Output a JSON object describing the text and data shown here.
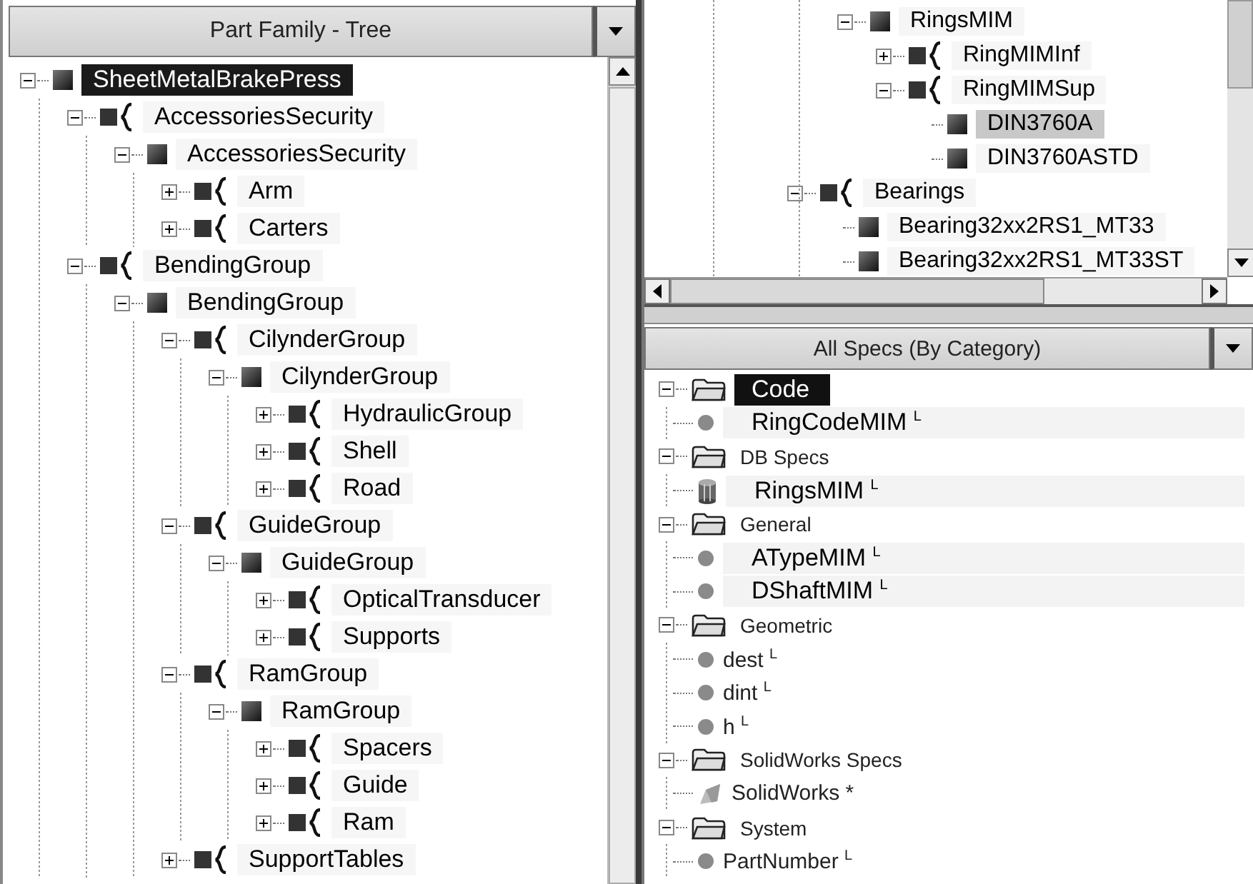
{
  "part_family_tree": {
    "header": "Part Family - Tree",
    "items": [
      {
        "kind": "part",
        "label": "SheetMetalBrakePress",
        "expanded": true,
        "selected": true,
        "children": [
          {
            "kind": "assembly",
            "label": "AccessoriesSecurity",
            "expanded": true,
            "selected": false,
            "children": [
              {
                "kind": "part",
                "label": "AccessoriesSecurity",
                "expanded": true,
                "selected": false,
                "children": [
                  {
                    "kind": "assembly",
                    "label": "Arm",
                    "expanded": false,
                    "selected": false
                  },
                  {
                    "kind": "assembly",
                    "label": "Carters",
                    "expanded": false,
                    "selected": false
                  }
                ]
              }
            ]
          },
          {
            "kind": "assembly",
            "label": "BendingGroup",
            "expanded": true,
            "selected": false,
            "children": [
              {
                "kind": "part",
                "label": "BendingGroup",
                "expanded": true,
                "selected": false,
                "children": [
                  {
                    "kind": "assembly",
                    "label": "CilynderGroup",
                    "expanded": true,
                    "selected": false,
                    "children": [
                      {
                        "kind": "part",
                        "label": "CilynderGroup",
                        "expanded": true,
                        "selected": false,
                        "children": [
                          {
                            "kind": "assembly",
                            "label": "HydraulicGroup",
                            "expanded": false,
                            "selected": false
                          },
                          {
                            "kind": "assembly",
                            "label": "Shell",
                            "expanded": false,
                            "selected": false
                          },
                          {
                            "kind": "assembly",
                            "label": "Road",
                            "expanded": false,
                            "selected": false
                          }
                        ]
                      }
                    ]
                  },
                  {
                    "kind": "assembly",
                    "label": "GuideGroup",
                    "expanded": true,
                    "selected": false,
                    "children": [
                      {
                        "kind": "part",
                        "label": "GuideGroup",
                        "expanded": true,
                        "selected": false,
                        "children": [
                          {
                            "kind": "assembly",
                            "label": "OpticalTransducer",
                            "expanded": false,
                            "selected": false
                          },
                          {
                            "kind": "assembly",
                            "label": "Supports",
                            "expanded": false,
                            "selected": false
                          }
                        ]
                      }
                    ]
                  },
                  {
                    "kind": "assembly",
                    "label": "RamGroup",
                    "expanded": true,
                    "selected": false,
                    "children": [
                      {
                        "kind": "part",
                        "label": "RamGroup",
                        "expanded": true,
                        "selected": false,
                        "children": [
                          {
                            "kind": "assembly",
                            "label": "Spacers",
                            "expanded": false,
                            "selected": false
                          },
                          {
                            "kind": "assembly",
                            "label": "Guide",
                            "expanded": false,
                            "selected": false
                          },
                          {
                            "kind": "assembly",
                            "label": "Ram",
                            "expanded": false,
                            "selected": false
                          }
                        ]
                      }
                    ]
                  },
                  {
                    "kind": "assembly",
                    "label": "SupportTables",
                    "expanded": false,
                    "selected": false
                  }
                ]
              }
            ]
          }
        ]
      }
    ]
  },
  "family_tree_detail": {
    "items": [
      {
        "children": [
          {
            "kind": "part",
            "label": "RingsMIM",
            "expanded": true,
            "selected": false,
            "children": [
              {
                "kind": "assembly",
                "label": "RingMIMInf",
                "expanded": false,
                "selected": false
              },
              {
                "kind": "assembly",
                "label": "RingMIMSup",
                "expanded": true,
                "selected": false,
                "children": [
                  {
                    "kind": "part",
                    "label": "DIN3760A",
                    "selected": true
                  },
                  {
                    "kind": "part",
                    "label": "DIN3760ASTD",
                    "selected": false
                  }
                ]
              }
            ]
          }
        ]
      },
      {
        "kind": "assembly",
        "label": "Bearings",
        "expanded": true,
        "selected": false,
        "children": [
          {
            "kind": "part",
            "label": "Bearing32xx2RS1_MT33",
            "selected": false
          },
          {
            "kind": "part",
            "label": "Bearing32xx2RS1_MT33ST",
            "selected": false
          }
        ]
      }
    ]
  },
  "all_specs": {
    "header": "All Specs (By Category)",
    "categories": [
      {
        "label": "Code",
        "expanded": true,
        "selected": true,
        "children": [
          {
            "kind": "parameter",
            "label": "RingCodeMIM $^{L}$",
            "highlighted": true
          }
        ]
      },
      {
        "label": "DB Specs",
        "expanded": true,
        "selected": false,
        "children": [
          {
            "kind": "database",
            "label": "RingsMIM $^{L}$",
            "highlighted": true
          }
        ]
      },
      {
        "label": "General",
        "expanded": true,
        "selected": false,
        "children": [
          {
            "kind": "parameter",
            "label": "ATypeMIM $^{L}$",
            "highlighted": true
          },
          {
            "kind": "parameter",
            "label": "DShaftMIM $^{L}$",
            "highlighted": true
          }
        ]
      },
      {
        "label": "Geometric",
        "expanded": true,
        "selected": false,
        "children": [
          {
            "kind": "parameter",
            "label": "dest $^{L}$",
            "highlighted": false
          },
          {
            "kind": "parameter",
            "label": "dint $^{L}$",
            "highlighted": false
          },
          {
            "kind": "parameter",
            "label": "h $^{L}$",
            "highlighted": false
          }
        ]
      },
      {
        "label": "SolidWorks Specs",
        "expanded": true,
        "selected": false,
        "children": [
          {
            "kind": "solidworks",
            "label": "SolidWorks *",
            "highlighted": false
          }
        ]
      },
      {
        "label": "System",
        "expanded": true,
        "selected": false,
        "children": [
          {
            "kind": "parameter",
            "label": "PartNumber $^{L}$",
            "highlighted": false
          }
        ]
      }
    ]
  }
}
